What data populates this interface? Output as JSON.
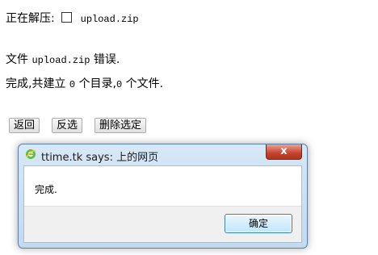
{
  "status": {
    "extracting_label": "正在解压:",
    "extracting_file": "upload.zip",
    "error_prefix": "文件",
    "error_file": "upload.zip",
    "error_suffix": "错误.",
    "done_prefix": "完成,共建立",
    "dir_count": "0",
    "dir_unit": "个目录,",
    "file_count": "0",
    "file_unit": "个文件."
  },
  "actions": {
    "back_label": "返回",
    "invert_label": "反选",
    "delete_label": "删除选定"
  },
  "dialog": {
    "title": "ttime.tk says: 上的网页",
    "message": "完成.",
    "ok_label": "确定",
    "close_glyph": "x"
  }
}
